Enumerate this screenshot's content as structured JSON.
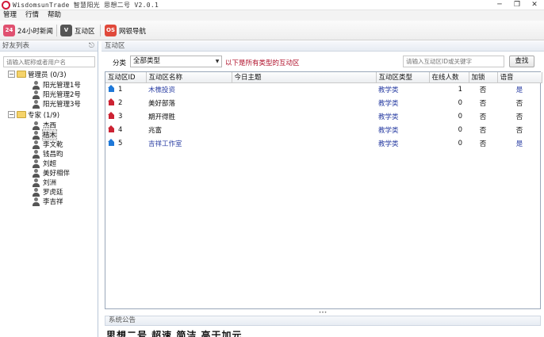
{
  "window": {
    "title": "WisdomsunTrade 智慧阳光 思想二号 V2.0.1"
  },
  "menu": [
    "管理",
    "行情",
    "帮助"
  ],
  "toolbar": {
    "news": {
      "icon_text": "24",
      "label": "24小时新闻",
      "color": "#e05170"
    },
    "interactive": {
      "icon_text": "V",
      "label": "互动区",
      "color": "#555555"
    },
    "nav": {
      "icon_text": "OS",
      "label": "网银导航",
      "color": "#e0493b"
    }
  },
  "friends": {
    "title": "好友列表",
    "search_placeholder": "请输入昵称或者用户名",
    "groups": [
      {
        "label": "管理员 (0/3)",
        "expander": "−",
        "members": [
          "阳光管理1号",
          "阳光管理2号",
          "阳光管理3号"
        ]
      },
      {
        "label": "专家 (1/9)",
        "expander": "−",
        "members": [
          "杰西",
          "桔木",
          "李文乾",
          "钱昌昀",
          "刘超",
          "美好相伴",
          "刘洲",
          "罗虎廷",
          "李吉祥"
        ]
      }
    ],
    "selected_member": "桔木"
  },
  "zone_panel": {
    "title": "互动区",
    "filter_label": "分类",
    "filter_value": "全部类型",
    "filter_note": "以下是所有类型的互动区",
    "search_placeholder": "请输入互动区ID或关键字",
    "search_button": "查找",
    "columns": [
      "互动区ID",
      "互动区名称",
      "今日主题",
      "互动区类型",
      "在线人数",
      "加锁",
      "语音"
    ],
    "rows": [
      {
        "id": "1",
        "name": "木樵投资",
        "topic": "",
        "type": "教学类",
        "online": "1",
        "locked": "否",
        "voice": "是",
        "icon_color": "#1e78d8",
        "name_color": "#2b3fa3"
      },
      {
        "id": "2",
        "name": "美好部落",
        "topic": "",
        "type": "教学类",
        "online": "0",
        "locked": "否",
        "voice": "否",
        "icon_color": "#cc2233",
        "name_color": "#111111"
      },
      {
        "id": "3",
        "name": "期开得胜",
        "topic": "",
        "type": "教学类",
        "online": "0",
        "locked": "否",
        "voice": "否",
        "icon_color": "#cc2233",
        "name_color": "#111111"
      },
      {
        "id": "4",
        "name": "兆富",
        "topic": "",
        "type": "教学类",
        "online": "0",
        "locked": "否",
        "voice": "否",
        "icon_color": "#cc2233",
        "name_color": "#111111"
      },
      {
        "id": "5",
        "name": "吉祥工作室",
        "topic": "",
        "type": "教学类",
        "online": "0",
        "locked": "否",
        "voice": "是",
        "icon_color": "#1e78d8",
        "name_color": "#2b3fa3"
      }
    ]
  },
  "announcement": {
    "title": "系统公告",
    "ticker": "思想二号  超速  简洁  高于加元"
  }
}
